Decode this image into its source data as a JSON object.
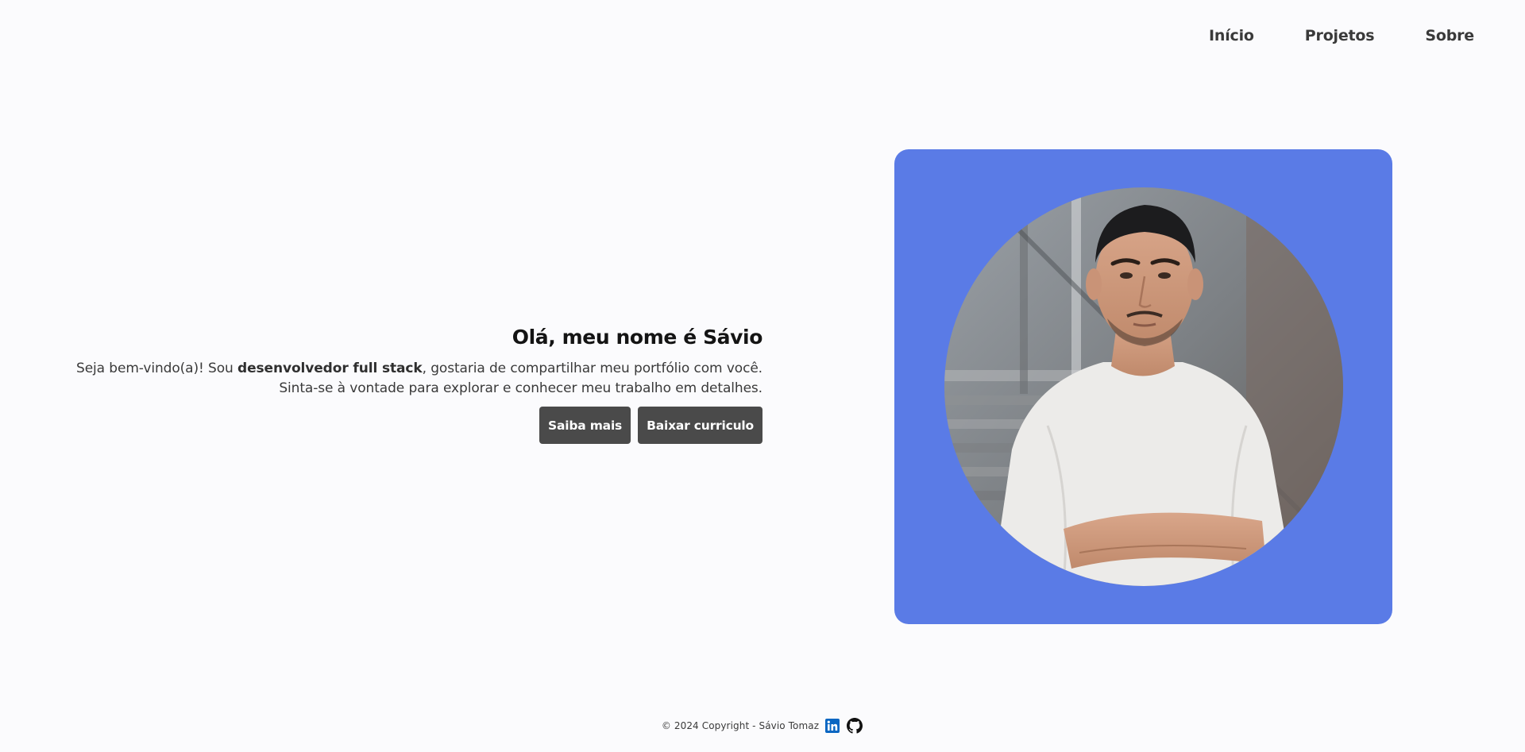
{
  "nav": {
    "items": [
      {
        "label": "Início"
      },
      {
        "label": "Projetos"
      },
      {
        "label": "Sobre"
      }
    ]
  },
  "hero": {
    "title": "Olá, meu nome é Sávio",
    "desc_part1": "Seja bem-vindo(a)! Sou ",
    "desc_bold": "desenvolvedor full stack",
    "desc_part2": ", gostaria de compartilhar meu portfólio com você.",
    "desc_line2": "Sinta-se à vontade para explorar e conhecer meu trabalho em detalhes.",
    "buttons": {
      "learn_more": "Saiba mais",
      "download_cv": "Baixar curriculo"
    }
  },
  "photo": {
    "background_color": "#5a7be6",
    "alt": "portrait-photo"
  },
  "footer": {
    "copyright": "© 2024 Copyright - Sávio Tomaz",
    "icons": [
      "linkedin-icon",
      "github-icon"
    ],
    "linkedin_color": "#0a66c2"
  }
}
